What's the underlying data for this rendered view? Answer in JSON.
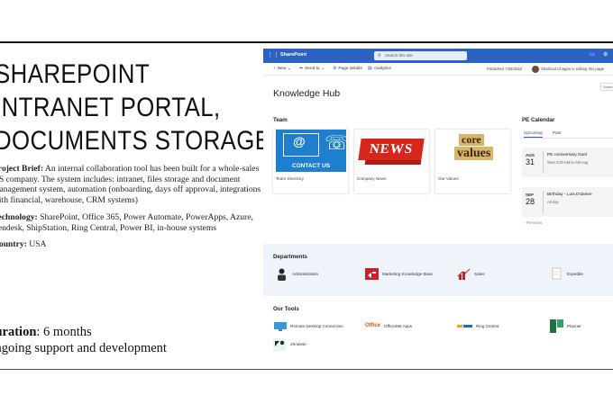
{
  "headline": [
    "SHAREPOINT",
    "INTRANET PORTAL,",
    "DOCUMENTS STORAGE"
  ],
  "brief": {
    "label": "Project Brief:",
    "text": "An internal collaboration tool has been built for a whole-sales US company. The system includes: intranet, files storage and document management system, automation (onboarding, days off approval, integrations with financial, warehouse, CRM systems)"
  },
  "technology": {
    "label": "Technology:",
    "text": "SharePoint, Office 365, Power Automate, PowerApps, Azure, Zendesk, ShipStation, Ring Central, Power BI, in-house systems"
  },
  "country": {
    "label": "Country:",
    "text": "USA"
  },
  "duration": {
    "label": "Duration",
    "text": ": 6 months",
    "line2": "Ongoing support and development"
  },
  "sharepoint": {
    "app_name": "SharePoint",
    "search_placeholder": "Search this site",
    "commands": [
      "New",
      "Send to",
      "Page details",
      "Analytics"
    ],
    "published": "Published 7/26/2022",
    "editing": "Shahzod Chagan is editing this page",
    "site_title": "Knowledge Hub",
    "share_label": "Share",
    "team": {
      "title": "Team",
      "cards": [
        {
          "image_text": "CONTACT US",
          "label": "Team Directory"
        },
        {
          "image_text": "NEWS",
          "label": "Company News"
        },
        {
          "image_text_1": "core",
          "image_text_2": "values",
          "label": "Our Values"
        }
      ]
    },
    "calendar": {
      "title": "PE Calendar",
      "tabs": [
        "Upcoming",
        "Past"
      ],
      "events": [
        {
          "month": "AUG",
          "day": "31",
          "name": "PE Anniversary Noel",
          "time": "Wed 3:00 AM to AM Aug"
        },
        {
          "month": "SEP",
          "day": "28",
          "name": "Birthday - Luis D'dariee",
          "time": "All day"
        }
      ],
      "previous": "Previous"
    },
    "departments": {
      "title": "Departments",
      "items": [
        "Administration",
        "Marketing Knowledge Base",
        "Sales",
        "Expedite"
      ]
    },
    "tools": {
      "title": "Our Tools",
      "items": [
        "Remote Desktop Connection",
        "Office365 Apps",
        "Ring Central",
        "Planner",
        "Zendesk"
      ],
      "office_logo": "Office"
    }
  }
}
